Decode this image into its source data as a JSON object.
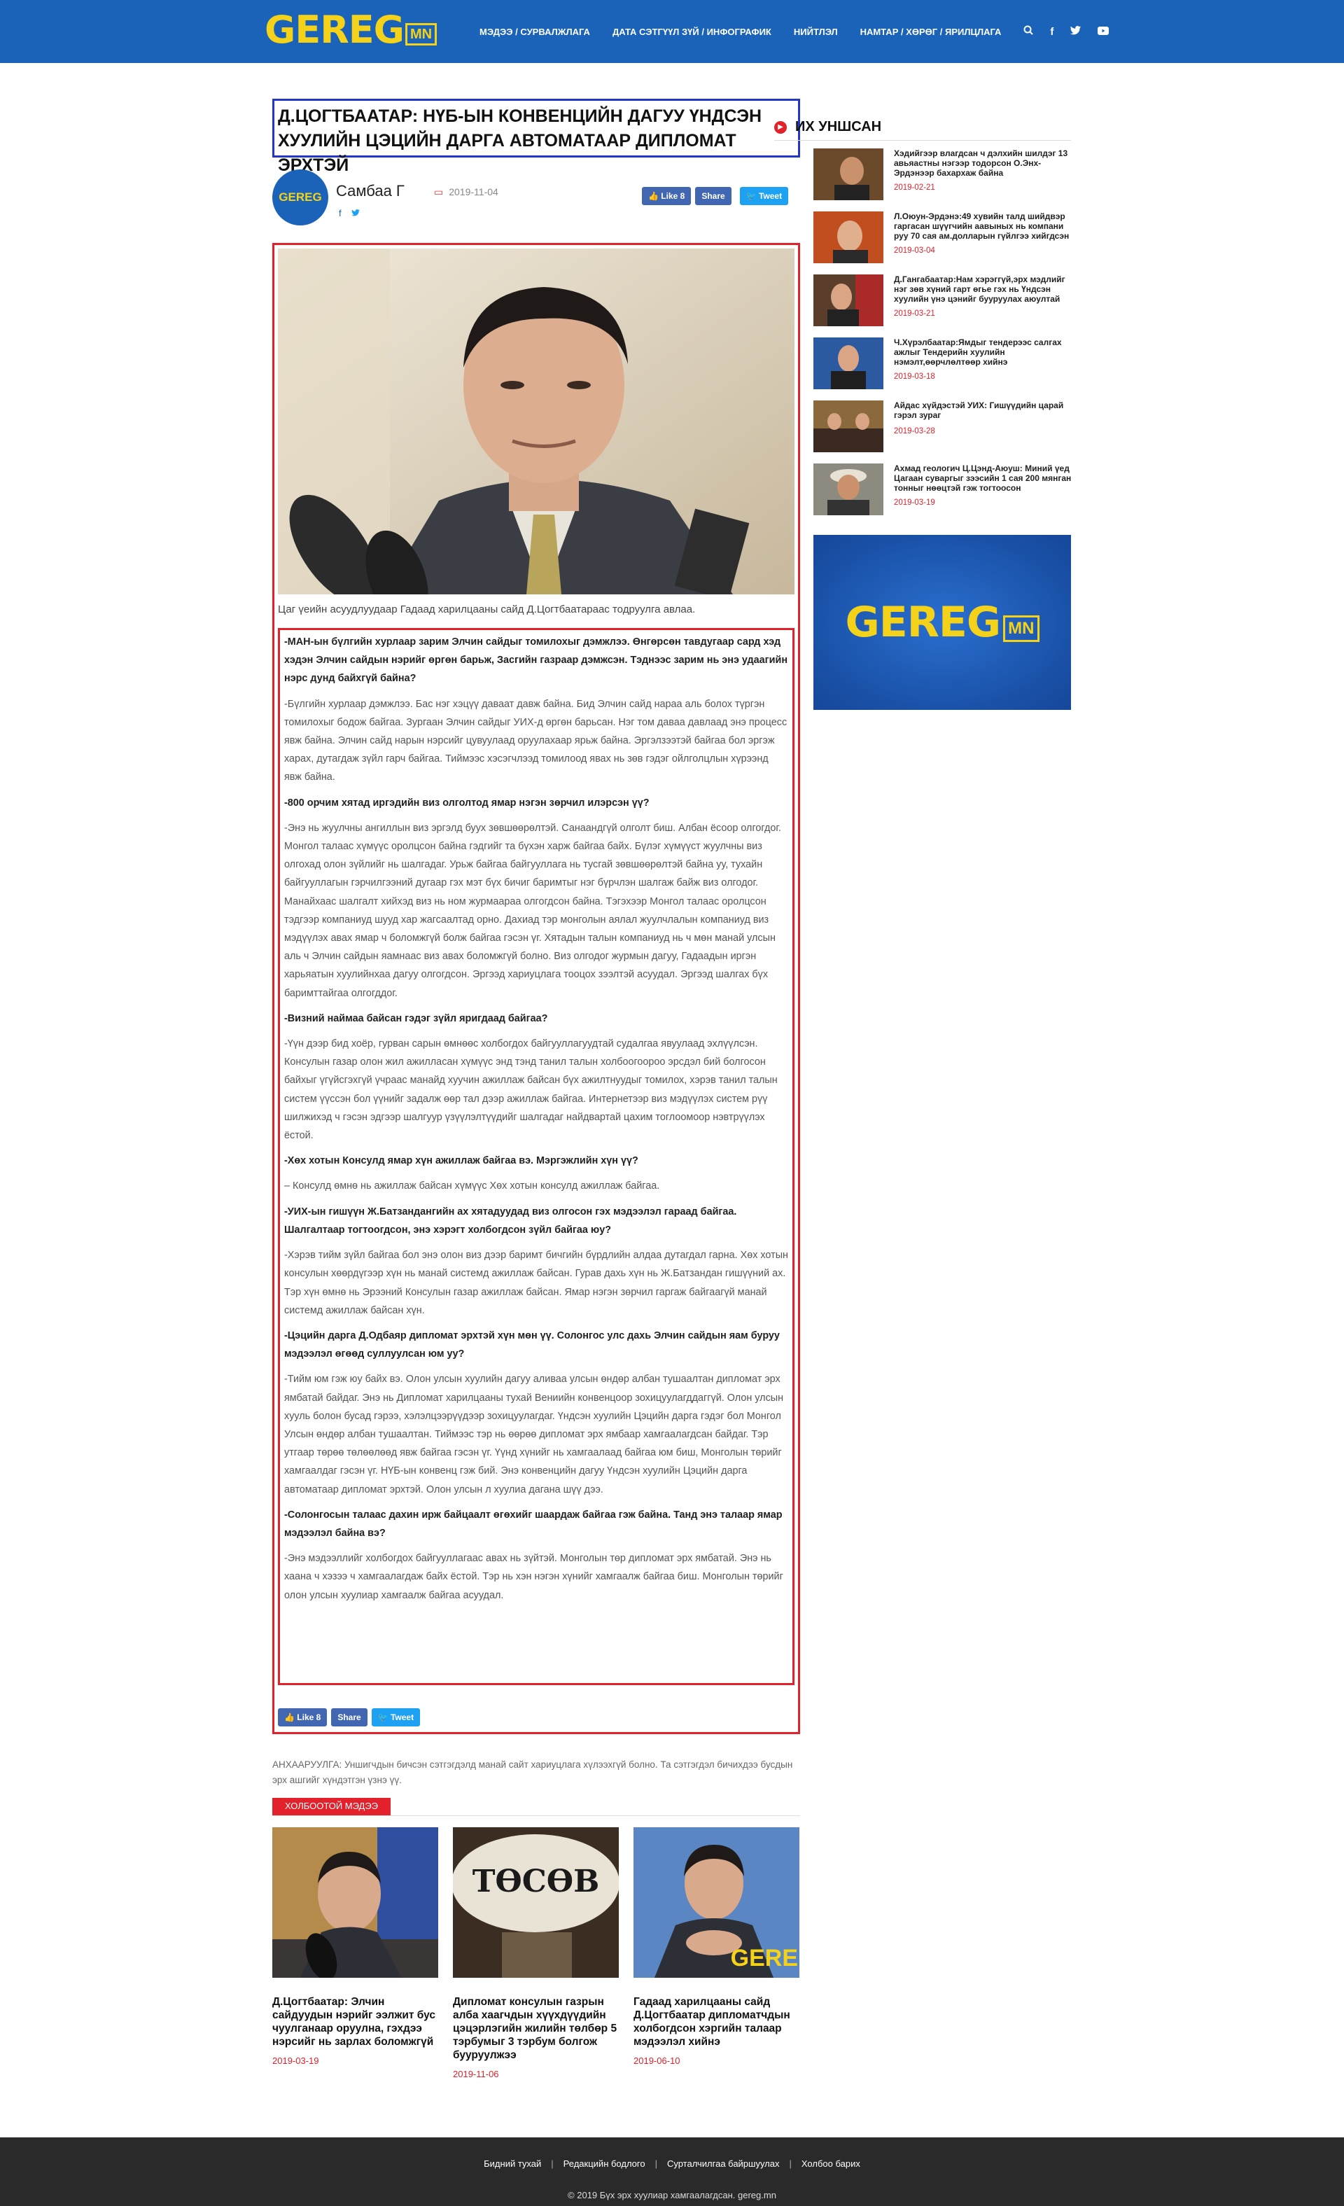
{
  "header": {
    "logo_main": "GEREG",
    "logo_suffix": "MN",
    "nav": [
      "МЭДЭЭ / СУРВАЛЖЛАГА",
      "ДАТА СЭТГҮҮЛ ЗҮЙ / ИНФОГРАФИК",
      "НИЙТЛЭЛ",
      "НАМТАР / ХӨРӨГ / ЯРИЛЦЛАГА"
    ],
    "icons": [
      "search-icon",
      "facebook-icon",
      "twitter-icon",
      "youtube-icon"
    ]
  },
  "article": {
    "title": "Д.ЦОГТБААТАР: НҮБ-ЫН КОНВЕНЦИЙН ДАГУУ ҮНДСЭН ХУУЛИЙН ЦЭЦИЙН ДАРГА АВТОМАТААР ДИПЛОМАТ ЭРХТЭЙ",
    "avatar_text": "GEREG",
    "author": "Самбаа Г",
    "date": "2019-11-04",
    "share": {
      "like": "Like 8",
      "share": "Share",
      "tweet": "Tweet"
    },
    "caption": "Цаг үеийн асуудлуудаар Гадаад харилцааны сайд Д.Цогтбаатараас тодруулга авлаа.",
    "paragraphs": [
      {
        "q": true,
        "text": "-МАН-ын бүлгийн хурлаар зарим Элчин сайдыг томилохыг дэмжлээ. Өнгөрсөн тавдугаар сард хэд хэдэн Элчин сайдын нэрийг өргөн барьж, Засгийн газраар дэмжсэн. Тэднээс зарим нь энэ удаагийн нэрс дунд байхгүй байна?"
      },
      {
        "q": false,
        "text": "-Бүлгийн хурлаар дэмжлээ. Бас нэг хэцүү даваат давж байна. Бид Элчин сайд нараа аль болох түргэн томилохыг бодож байгаа. Зургаан Элчин сайдыг УИХ-д өргөн барьсан. Нэг том даваа давлаад энэ процесс явж байна. Элчин сайд нарын нэрсийг цувуулаад оруулахаар ярьж байна. Эргэлзээтэй байгаа бол эргэж харах, дутагдаж зүйл гарч байгаа. Тиймээс хэсэгчлээд томилоод явах нь зөв гэдэг ойлголцлын хүрээнд явж байна."
      },
      {
        "q": true,
        "text": "-800 орчим хятад иргэдийн виз олголтод ямар нэгэн зөрчил илэрсэн үү?"
      },
      {
        "q": false,
        "text": "-Энэ нь жуулчны ангиллын виз эргэлд буух зөвшөөрөлтэй. Санаандгүй олголт биш. Албан ёсоор олгогдог. Монгол талаас хүмүүс оролцсон байна гэдгийг та бүхэн харж байгаа байх. Бүлэг хүмүүст жуулчны виз олгохад олон зүйлийг нь шалгадаг. Урьж байгаа байгууллага нь тусгай зөвшөөрөлтэй байна уу, тухайн байгууллагын гэрчилгээний дугаар гэх мэт бүх бичиг баримтыг нэг бүрчлэн шалгаж байж виз олгодог. Манайхаас шалгалт хийхэд виз нь ном журмаараа олгогдсон байна. Тэгэхээр Монгол талаас оролцсон тэдгээр компаниуд шууд хар жагсаалтад орно. Дахиад тэр монголын аялал жуулчлалын компаниуд виз мэдүүлэх авах ямар ч боломжгүй болж байгаа гэсэн үг. Хятадын талын компаниуд нь ч мөн манай улсын аль ч Элчин сайдын яамнаас виз авах боломжгүй болно. Виз олгодог журмын дагуу, Гадаадын иргэн харьяатын хуулийнхаа дагуу олгогдсон. Эргээд хариуцлага тооцох зээлтэй асуудал. Эргээд шалгах бүх баримттайгаа олгогддог."
      },
      {
        "q": true,
        "text": "-Визний наймаа байсан гэдэг зүйл яригдаад байгаа?"
      },
      {
        "q": false,
        "text": "-Үүн дээр бид хоёр, гурван сарын өмнөөс холбогдох байгууллагуудтай судалгаа явуулаад эхлүүлсэн. Консулын газар олон жил ажилласан хүмүүс энд тэнд танил талын холбоогоороо эрсдэл бий болгосон байхыг үгүйсгэхгүй үчраас манайд хуучин ажиллаж байсан бүх ажилтнуудыг томилох, хэрэв танил талын систем үүссэн бол үүнийг задалж өөр тал дээр ажиллаж байгаа. Интернетээр виз мэдүүлэх систем рүү шилжихэд ч гэсэн эдгээр шалгуур үзүүлэлтүүдийг шалгадаг найдвартай цахим тоглоомоор нэвтрүүлэх ёстой."
      },
      {
        "q": true,
        "text": "-Хөх хотын Консулд ямар хүн ажиллаж байгаа вэ. Мэргэжлийн хүн үү?"
      },
      {
        "q": false,
        "text": "– Консулд өмнө нь ажиллаж байсан хүмүүс Хөх хотын консулд ажиллаж байгаа."
      },
      {
        "q": true,
        "text": "-УИХ-ын гишүүн Ж.Батзандангийн ах хятадуудад виз олгосон гэх мэдээлэл гараад байгаа. Шалгалтаар тогтоогдсон, энэ хэрэгт холбогдсон зүйл байгаа юу?"
      },
      {
        "q": false,
        "text": "-Хэрэв тийм зүйл байгаа бол энэ олон виз дээр баримт бичгийн бүрдлийн алдаа дутагдал гарна. Хөх хотын консулын хөөрдүгээр хүн нь манай системд ажиллаж байсан. Гурав дахь хүн нь Ж.Батзандан гишүүний ах. Тэр хүн өмнө нь Эрээний Консулын газар ажиллаж байсан. Ямар нэгэн зөрчил гаргаж байгаагүй манай системд ажиллаж байсан хүн."
      },
      {
        "q": true,
        "text": "-Цэцийн дарга Д.Одбаяр дипломат эрхтэй хүн мөн үү. Солонгос улс дахь Элчин сайдын яам буруу мэдээлэл өгөөд суллуулсан юм уу?"
      },
      {
        "q": false,
        "text": "-Тийм юм гэж юу байх вэ. Олон улсын хуулийн дагуу аливаа улсын өндөр албан тушаалтан дипломат эрх ямбатай байдаг. Энэ нь Дипломат харилцааны тухай Вениийн конвенцоор зохицуулагддаггүй. Олон улсын хууль болон бусад гэрээ, хэлэлцээрүүдээр зохицуулагдаг. Үндсэн хуулийн Цэцийн дарга гэдэг бол Монгол Улсын өндөр албан тушаалтан. Тиймээс тэр нь өөрөө дипломат эрх ямбаар хамгаалагдсан байдаг. Тэр утгаар төрөө төлөөлөөд явж байгаа гэсэн үг. Үүнд хүнийг нь хамгаалаад байгаа юм биш, Монголын төрийг хамгаалдаг гэсэн үг. НҮБ-ын конвенц гэж бий. Энэ конвенцийн дагуу Үндсэн хуулийн Цэцийн дарга автоматаар дипломат эрхтэй. Олон улсын л хуулиа дагана шүү дээ."
      },
      {
        "q": true,
        "text": "-Солонгосын талаас дахин ирж байцаалт өгөхийг шаардаж байгаа гэж байна. Танд энэ талаар ямар мэдээлэл байна вэ?"
      },
      {
        "q": false,
        "text": "-Энэ мэдээллийг холбогдох байгууллагаас авах нь зүйтэй. Монголын төр дипломат эрх ямбатай. Энэ нь хаана ч хэзээ ч хамгаалагдаж байх ёстой. Тэр нь хэн нэгэн хүнийг хамгаалж байгаа биш. Монголын төрийг олон улсын хуулиар хамгаалж байгаа асуудал."
      }
    ],
    "notice": "АНХААРУУЛГА: Уншигчдын бичсэн сэтгэгдэлд манай сайт хариуцлага хүлээхгүй болно. Та сэтгэгдэл бичихдээ бусдын эрх ашгийг хүндэтгэн үзнэ үү."
  },
  "related": {
    "label": "ХОЛБООТОЙ МЭДЭЭ",
    "items": [
      {
        "title": "Д.Цогтбаатар: Элчин сайдуудын нэрийг ээлжит бус чуулганаар оруулна, гэхдээ нэрсийг нь зарлах боломжгүй",
        "date": "2019-03-19"
      },
      {
        "title": "Дипломат консулын газрын алба хаагчдын хүүхдүүдийн цэцэрлэгийн жилийн төлбөр 5 тэрбумыг 3 тэрбум болгож бууруулжээ",
        "date": "2019-11-06",
        "image_text": "ТӨСӨВ"
      },
      {
        "title": "Гадаад харилцааны сайд Д.Цогтбаатар дипломатчдын холбогдсон хэргийн талаар мэдээлэл хийнэ",
        "date": "2019-06-10",
        "image_text": "GERE"
      }
    ]
  },
  "sidebar": {
    "title": "ИХ УНШСАН",
    "items": [
      {
        "title": "Хэдийгээр влагдсан ч дэлхийн шилдэг 13 авьяастны нэгээр тодорсон О.Энх-Эрдэнээр бахархаж байна",
        "date": "2019-02-21"
      },
      {
        "title": "Л.Оюун-Эрдэнэ:49 хувийн талд шийдвэр гаргасан шүүгчийн аавыных нь компани руу 70 сая ам.долларын гүйлгээ хийгдсэн",
        "date": "2019-03-04"
      },
      {
        "title": "Д.Ганга­баатар:Нам хэрэггүй,эрх мэдлийг нэг зөв хүний гарт өгье гэх нь Үндсэн хуулийн үнэ цэнийг бууруулах аюултай",
        "date": "2019-03-21"
      },
      {
        "title": "Ч.Хүрэлбаатар:Ямдыг тендерээс салгах ажлыг Тендерийн хуулийн нэмэлт,өөрчлөлтөөр хийнэ",
        "date": "2019-03-18"
      },
      {
        "title": "Айдас хүйдэстэй УИХ: Гишүүдийн царай гэрэл зураг",
        "date": "2019-03-28"
      },
      {
        "title": "Ахмад геологич Ц.Цэнд-Аюуш: Миний үед Цагаан суваргыг зээсийн 1 сая 200 мянган тонныг нөөцтэй гэж тогтоосон",
        "date": "2019-03-19"
      }
    ],
    "ad_text": "GEREG",
    "ad_suffix": "MN"
  },
  "footer": {
    "links": [
      "Бидний тухай",
      "Редакцийн бодлого",
      "Сурталчилгаа байршуулах",
      "Холбоо барих"
    ],
    "copyright": "© 2019 Бүх эрх хуулиар хамгаалагдсан. gereg.mn"
  },
  "colors": {
    "brand_blue": "#1a63b8",
    "logo_yellow": "#f5d21a",
    "accent_red": "#e2212b",
    "facebook": "#4267b2",
    "twitter": "#1da1f2"
  }
}
